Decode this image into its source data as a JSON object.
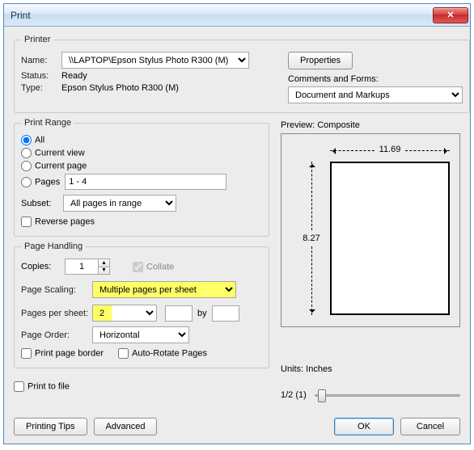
{
  "window": {
    "title": "Print"
  },
  "printer": {
    "legend": "Printer",
    "name_label": "Name:",
    "name_value": "\\\\LAPTOP\\Epson Stylus Photo R300 (M)",
    "status_label": "Status:",
    "status_value": "Ready",
    "type_label": "Type:",
    "type_value": "Epson Stylus Photo R300 (M)",
    "properties_btn": "Properties",
    "comments_label": "Comments and Forms:",
    "comments_value": "Document and Markups"
  },
  "range": {
    "legend": "Print Range",
    "all": "All",
    "current_view": "Current view",
    "current_page": "Current page",
    "pages_label": "Pages",
    "pages_value": "1 - 4",
    "subset_label": "Subset:",
    "subset_value": "All pages in range",
    "reverse": "Reverse pages"
  },
  "handling": {
    "legend": "Page Handling",
    "copies_label": "Copies:",
    "copies_value": "1",
    "collate": "Collate",
    "scaling_label": "Page Scaling:",
    "scaling_value": "Multiple pages per sheet",
    "pps_label": "Pages per sheet:",
    "pps_value": "2",
    "by": "by",
    "order_label": "Page Order:",
    "order_value": "Horizontal",
    "border": "Print page border",
    "autorotate": "Auto-Rotate Pages"
  },
  "preview": {
    "label": "Preview: Composite",
    "width": "11.69",
    "height": "8.27",
    "units": "Units: Inches",
    "zoom": "1/2 (1)"
  },
  "footer": {
    "print_to_file": "Print to file",
    "tips": "Printing Tips",
    "advanced": "Advanced",
    "ok": "OK",
    "cancel": "Cancel"
  }
}
